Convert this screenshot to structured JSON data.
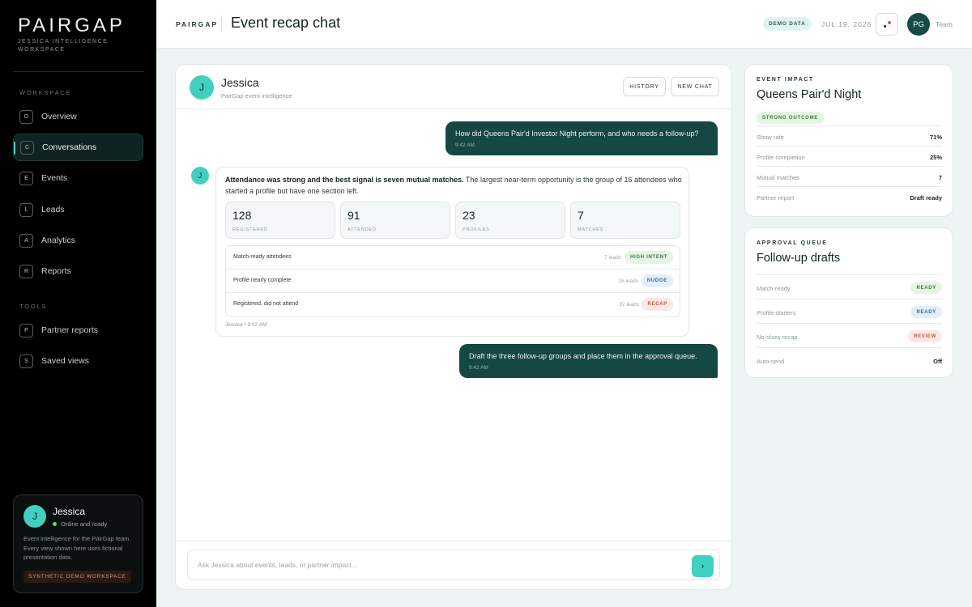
{
  "sidebar": {
    "logo": "PAIRGAP",
    "logo_sub": "JESSICA INTELLIGENCE WORKSPACE",
    "workspace_label": "WORKSPACE",
    "tools_label": "TOOLS",
    "items": [
      {
        "key": "O",
        "label": "Overview"
      },
      {
        "key": "C",
        "label": "Conversations",
        "active": true
      },
      {
        "key": "E",
        "label": "Events"
      },
      {
        "key": "L",
        "label": "Leads"
      },
      {
        "key": "A",
        "label": "Analytics"
      },
      {
        "key": "R",
        "label": "Reports"
      }
    ],
    "tools": [
      {
        "key": "P",
        "label": "Partner reports"
      },
      {
        "key": "S",
        "label": "Saved views"
      }
    ],
    "profile": {
      "initial": "J",
      "name": "Jessica",
      "status": "Online and ready",
      "description": "Event intelligence for the PairGap team. Every view shown here uses fictional presentation data.",
      "badge": "SYNTHETIC DEMO WORKSPACE"
    }
  },
  "header": {
    "brand": "PAIRGAP",
    "title": "Event recap chat",
    "demo_badge": "DEMO DATA",
    "date": "JUL 19, 2026",
    "avatar": "PG",
    "team": "Team"
  },
  "chat": {
    "avatar": "J",
    "name": "Jessica",
    "subtitle": "PairGap event intelligence",
    "history_btn": "HISTORY",
    "new_chat_btn": "NEW CHAT",
    "msg1": {
      "text": "How did Queens Pair'd Investor Night perform, and who needs a follow-up?",
      "time": "9:42 AM"
    },
    "bot": {
      "avatar": "J",
      "bold": "Attendance was strong and the best signal is seven mutual matches.",
      "text": " The largest near-term opportunity is the group of 16 attendees who started a profile but have one section left.",
      "stats": [
        {
          "value": "128",
          "label": "REGISTERED"
        },
        {
          "value": "91",
          "label": "ATTENDED"
        },
        {
          "value": "23",
          "label": "PROFILES"
        },
        {
          "value": "7",
          "label": "MATCHES"
        }
      ],
      "leads": [
        {
          "label": "Match-ready attendees",
          "count": "7 leads",
          "badge": "HIGH INTENT"
        },
        {
          "label": "Profile nearly complete",
          "count": "16 leads",
          "badge": "NUDGE"
        },
        {
          "label": "Registered, did not attend",
          "count": "37 leads",
          "badge": "RECAP"
        }
      ],
      "time": "Jessica • 9:42 AM"
    },
    "msg2": {
      "text": "Draft the three follow-up groups and place them in the approval queue.",
      "time": "9:42 AM"
    },
    "composer_placeholder": "Ask Jessica about events, leads, or partner impact...",
    "send_icon": "›"
  },
  "impact": {
    "eyebrow": "EVENT IMPACT",
    "title": "Queens Pair'd Night",
    "badge": "STRONG OUTCOME",
    "rows": [
      {
        "label": "Show rate",
        "value": "71%"
      },
      {
        "label": "Profile completion",
        "value": "25%"
      },
      {
        "label": "Mutual matches",
        "value": "7"
      },
      {
        "label": "Partner report",
        "value": "Draft ready"
      }
    ]
  },
  "queue": {
    "eyebrow": "APPROVAL QUEUE",
    "title": "Follow-up drafts",
    "rows": [
      {
        "label": "Match-ready",
        "badge": "READY"
      },
      {
        "label": "Profile starters",
        "badge": "READY"
      },
      {
        "label": "No-show recap",
        "badge": "REVIEW"
      },
      {
        "label": "Auto-send",
        "value": "Off"
      }
    ]
  }
}
